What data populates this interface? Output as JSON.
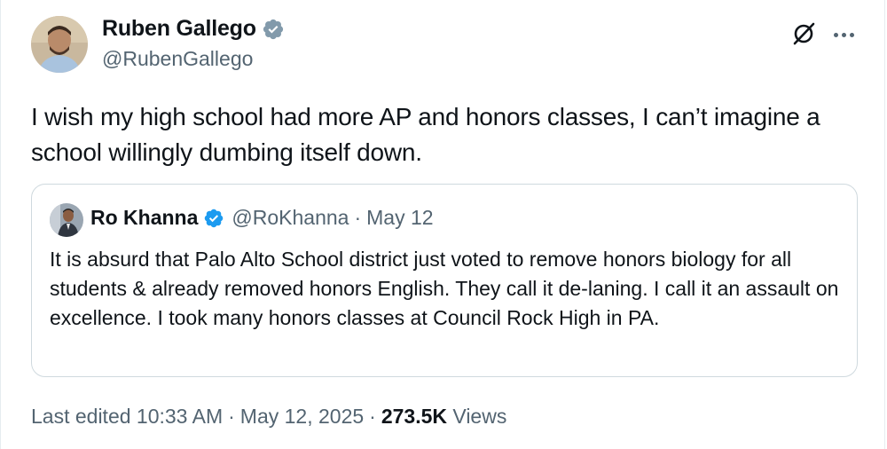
{
  "author": {
    "name": "Ruben Gallego",
    "handle": "@RubenGallego",
    "verified_color": "#829aab"
  },
  "tweet": {
    "text": "I wish my high school had more AP and honors classes, I can’t imagine a school willingly dumbing itself down."
  },
  "quoted": {
    "name": "Ro Khanna",
    "handle": "@RoKhanna",
    "separator": "·",
    "date": "May 12",
    "verified_color": "#1d9bf0",
    "text": "It is absurd that Palo Alto School district just voted to remove honors biology for all students & already removed honors English. They call it de-laning. I call it an assault on excellence. I took many honors classes at Council Rock High in PA."
  },
  "meta": {
    "edited": "Last edited 10:33 AM",
    "separator": "·",
    "date": "May 12, 2025",
    "views_count": "273.5K",
    "views_label": "Views"
  },
  "icons": {
    "grok": "grok-icon",
    "more": "more-icon",
    "verified": "verified-badge-icon"
  }
}
